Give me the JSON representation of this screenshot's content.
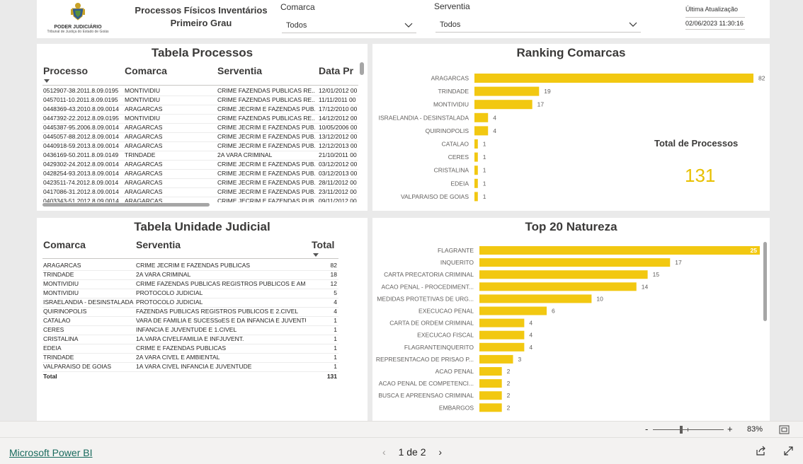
{
  "header": {
    "logo_line1": "PODER JUDICIÁRIO",
    "logo_line2": "Tribunal de Justiça do Estado de Goiás",
    "report_title_line1": "Processos Físicos Inventários",
    "report_title_line2": "Primeiro Grau",
    "comarca_label": "Comarca",
    "comarca_value": "Todos",
    "serventia_label": "Serventia",
    "serventia_value": "Todos",
    "update_label": "Última Atualização",
    "update_value": "02/06/2023 11:30:16"
  },
  "tabela_processos": {
    "title": "Tabela Processos",
    "columns": [
      "Processo",
      "Comarca",
      "Serventia",
      "Data Pr"
    ],
    "rows": [
      [
        "0512907-38.2011.8.09.0195",
        "MONTIVIDIU",
        "CRIME FAZENDAS PUBLICAS RE...",
        "12/01/2012 00"
      ],
      [
        "0457011-10.2011.8.09.0195",
        "MONTIVIDIU",
        "CRIME FAZENDAS PUBLICAS RE...",
        "11/11/2011 00"
      ],
      [
        "0448369-43.2010.8.09.0014",
        "ARAGARCAS",
        "CRIME JECRIM E FAZENDAS PUB...",
        "17/12/2010 00"
      ],
      [
        "0447392-22.2012.8.09.0195",
        "MONTIVIDIU",
        "CRIME FAZENDAS PUBLICAS RE...",
        "14/12/2012 00"
      ],
      [
        "0445387-95.2006.8.09.0014",
        "ARAGARCAS",
        "CRIME JECRIM E FAZENDAS PUB...",
        "10/05/2006 00"
      ],
      [
        "0445057-88.2012.8.09.0014",
        "ARAGARCAS",
        "CRIME JECRIM E FAZENDAS PUB...",
        "13/12/2012 00"
      ],
      [
        "0440918-59.2013.8.09.0014",
        "ARAGARCAS",
        "CRIME JECRIM E FAZENDAS PUB...",
        "12/12/2013 00"
      ],
      [
        "0436169-50.2011.8.09.0149",
        "TRINDADE",
        "2A VARA CRIMINAL",
        "21/10/2011 00"
      ],
      [
        "0429302-24.2012.8.09.0014",
        "ARAGARCAS",
        "CRIME JECRIM E FAZENDAS PUB...",
        "03/12/2012 00"
      ],
      [
        "0428254-93.2013.8.09.0014",
        "ARAGARCAS",
        "CRIME JECRIM E FAZENDAS PUB...",
        "03/12/2013 00"
      ],
      [
        "0423511-74.2012.8.09.0014",
        "ARAGARCAS",
        "CRIME JECRIM E FAZENDAS PUB...",
        "28/11/2012 00"
      ],
      [
        "0417086-31.2012.8.09.0014",
        "ARAGARCAS",
        "CRIME JECRIM E FAZENDAS PUB...",
        "23/11/2012 00"
      ],
      [
        "0403343-51.2012.8.09.0014",
        "ARAGARCAS",
        "CRIME JECRIM E FAZENDAS PUB...",
        "09/11/2012 00"
      ]
    ]
  },
  "tabela_unidade": {
    "title": "Tabela Unidade Judicial",
    "columns": [
      "Comarca",
      "Serventia",
      "Total"
    ],
    "rows": [
      [
        "ARAGARCAS",
        "CRIME JECRIM E FAZENDAS PUBLICAS",
        "82"
      ],
      [
        "TRINDADE",
        "2A VARA CRIMINAL",
        "18"
      ],
      [
        "MONTIVIDIU",
        "CRIME FAZENDAS PUBLICAS REGISTROS PUBLICOS E AMBI...",
        "12"
      ],
      [
        "MONTIVIDIU",
        "PROTOCOLO JUDICIAL",
        "5"
      ],
      [
        "ISRAELANDIA - DESINSTALADA",
        "PROTOCOLO JUDICIAL",
        "4"
      ],
      [
        "QUIRINOPOLIS",
        "FAZENDAS PUBLICAS REGISTROS PUBLICOS E 2.CIVEL",
        "4"
      ],
      [
        "CATALAO",
        "VARA DE FAMILIA E SUCESSoES E DA INFANCIA E JUVENTU...",
        "1"
      ],
      [
        "CERES",
        "INFANCIA E JUVENTUDE E 1.CIVEL",
        "1"
      ],
      [
        "CRISTALINA",
        "1A.VARA CIVELFAMILIA E INFJUVENT.",
        "1"
      ],
      [
        "EDEIA",
        "CRIME E FAZENDAS PUBLICAS",
        "1"
      ],
      [
        "TRINDADE",
        "2A VARA CIVEL E AMBIENTAL",
        "1"
      ],
      [
        "VALPARAISO DE GOIAS",
        "1A VARA CIVEL INFANCIA E JUVENTUDE",
        "1"
      ]
    ],
    "total_label": "Total",
    "total_value": "131"
  },
  "total_processos": {
    "label": "Total de Processos",
    "value": "131"
  },
  "colors": {
    "bar": "#f2c811",
    "total_value": "#e8c000"
  },
  "chart_data": [
    {
      "type": "bar",
      "orientation": "horizontal",
      "title": "Ranking Comarcas",
      "categories": [
        "ARAGARCAS",
        "TRINDADE",
        "MONTIVIDIU",
        "ISRAELANDIA - DESINSTALADA",
        "QUIRINOPOLIS",
        "CATALAO",
        "CERES",
        "CRISTALINA",
        "EDEIA",
        "VALPARAISO DE GOIAS"
      ],
      "values": [
        82,
        19,
        17,
        4,
        4,
        1,
        1,
        1,
        1,
        1
      ],
      "xlim": [
        0,
        82
      ],
      "data_labels": true,
      "grid": false
    },
    {
      "type": "bar",
      "orientation": "horizontal",
      "title": "Top 20 Natureza",
      "categories": [
        "FLAGRANTE",
        "INQUERITO",
        "CARTA PRECATORIA CRIMINAL",
        "ACAO PENAL - PROCEDIMENT...",
        "MEDIDAS PROTETIVAS DE URG...",
        "EXECUCAO PENAL",
        "CARTA DE ORDEM CRIMINAL",
        "EXECUCAO FISCAL",
        "FLAGRANTEINQUERITO",
        "REPRESENTACAO DE PRISAO P...",
        "ACAO PENAL",
        "ACAO PENAL DE COMPETENCI...",
        "BUSCA E APREENSAO CRIMINAL",
        "EMBARGOS"
      ],
      "values": [
        25,
        17,
        15,
        14,
        10,
        6,
        4,
        4,
        4,
        3,
        2,
        2,
        2,
        2
      ],
      "xlim": [
        0,
        25
      ],
      "data_labels": true,
      "grid": false
    }
  ],
  "status_bar": {
    "zoom_minus": "-",
    "zoom_plus": "+",
    "zoom_value": "83%"
  },
  "footer": {
    "brand_link": "Microsoft Power BI",
    "page_indicator": "1 de 2",
    "prev_icon": "‹",
    "next_icon": "›"
  }
}
